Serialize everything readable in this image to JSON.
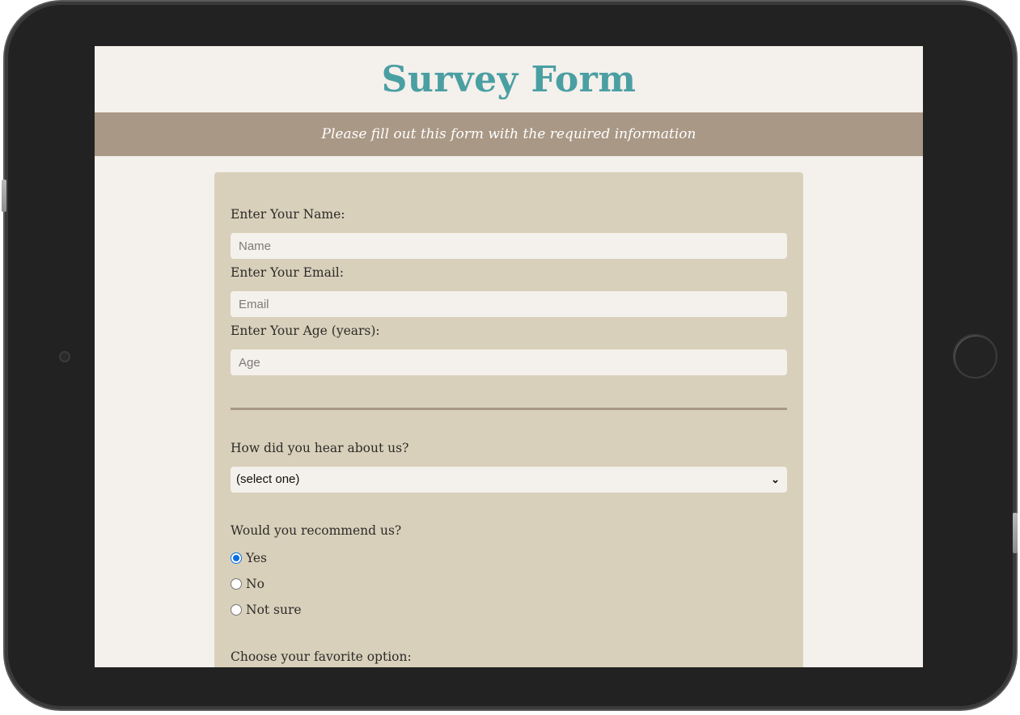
{
  "title": "Survey Form",
  "description": "Please fill out this form with the required information",
  "fields": {
    "name": {
      "label": "Enter Your Name:",
      "placeholder": "Name"
    },
    "email": {
      "label": "Enter Your Email:",
      "placeholder": "Email"
    },
    "age": {
      "label": "Enter Your Age (years):",
      "placeholder": "Age"
    }
  },
  "referral": {
    "label": "How did you hear about us?",
    "selected": "(select one)"
  },
  "recommend": {
    "label": "Would you recommend us?",
    "options": [
      "Yes",
      "No",
      "Not sure"
    ],
    "selected": "Yes"
  },
  "favorite": {
    "label": "Choose your favorite option:"
  },
  "colors": {
    "accent": "#4a9fa3",
    "banner": "#a99885",
    "card": "#d9d0bb",
    "background": "#f4f0eb",
    "radio_checked": "#0b6fe0"
  },
  "icons": {
    "select_chevron": "chevron-down-icon",
    "home": "home-button-icon",
    "camera": "camera-icon"
  }
}
